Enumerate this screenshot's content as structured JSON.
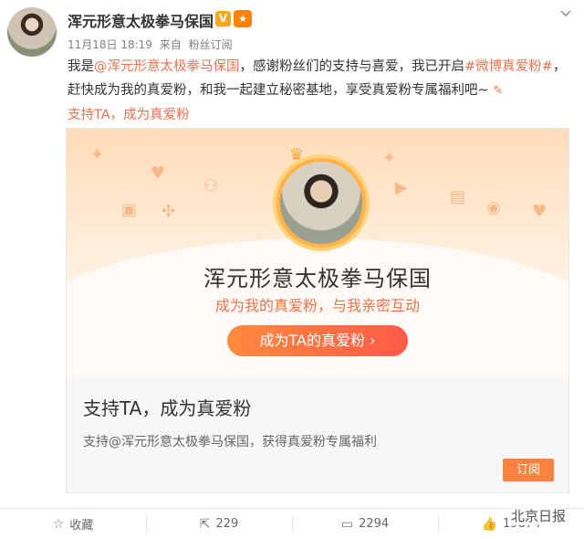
{
  "post": {
    "author": "浑元形意太极拳马保国",
    "badge_v": "V",
    "time": "11月18日 18:19",
    "source_prefix": "来自",
    "source": "粉丝订阅",
    "text": {
      "p1": "我是",
      "mention": "@浑元形意太极拳马保国",
      "p2": "，感谢粉丝们的支持与喜爱，我已开启",
      "hashtag": "#微博真爱粉#",
      "p3": "，赶快成为我的真爱粉，和我一起建立秘密基地，享受真爱粉专属福利吧~",
      "link": "支持TA，成为真爱粉"
    }
  },
  "card": {
    "name": "浑元形意太极拳马保国",
    "subtitle": "成为我的真爱粉，与我亲密互动",
    "cta_label": "成为TA的真爱粉",
    "cta_arrow": "›",
    "title": "支持TA，成为真爱粉",
    "desc": "支持@浑元形意太极拳马保国，获得真爱粉专属福利",
    "subscribe_label": "订阅"
  },
  "footer": {
    "favorite_label": "收藏",
    "repost_count": "229",
    "comment_count": "2294",
    "like_count": "19874"
  },
  "watermark": "北京日报",
  "colors": {
    "accent": "#eb7350",
    "button": "#ff8140"
  },
  "icons": [
    "star-icon",
    "repost-icon",
    "comment-icon",
    "like-icon",
    "edit-icon",
    "chevron-down-icon"
  ]
}
